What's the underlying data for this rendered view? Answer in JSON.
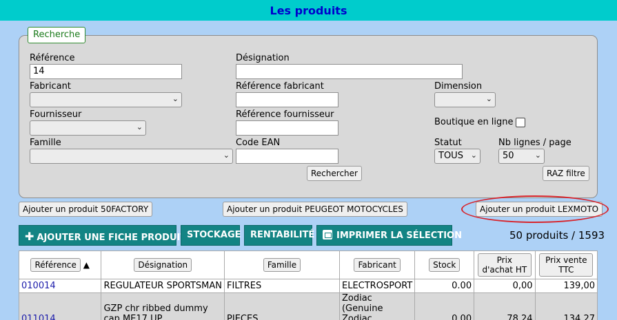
{
  "page_title": "Les produits",
  "search": {
    "legend": "Recherche",
    "reference_label": "Référence",
    "reference_value": "14",
    "designation_label": "Désignation",
    "designation_value": "",
    "fabricant_label": "Fabricant",
    "fabricant_value": "",
    "ref_fabricant_label": "Référence fabricant",
    "ref_fabricant_value": "",
    "dimension_label": "Dimension",
    "dimension_value": "",
    "fournisseur_label": "Fournisseur",
    "fournisseur_value": "",
    "ref_fournisseur_label": "Référence fournisseur",
    "ref_fournisseur_value": "",
    "boutique_label": "Boutique en ligne",
    "famille_label": "Famille",
    "famille_value": "",
    "ean_label": "Code EAN",
    "ean_value": "",
    "statut_label": "Statut",
    "statut_value": "TOUS",
    "nb_lignes_label": "Nb lignes / page",
    "nb_lignes_value": "50",
    "search_button": "Rechercher",
    "reset_button": "RAZ filtre"
  },
  "add_buttons": {
    "factory": "Ajouter un produit 50FACTORY",
    "peugeot": "Ajouter un produit PEUGEOT MOTOCYCLES",
    "lexmoto": "Ajouter un produit LEXMOTO"
  },
  "actions": {
    "add_product": "AJOUTER UNE FICHE PRODUIT",
    "stockage": "STOCKAGE",
    "rentabilite": "RENTABILITÉ",
    "print": "IMPRIMER LA SÉLECTION"
  },
  "count_text": "50 produits / 1593",
  "table": {
    "headers": {
      "reference": "Référence",
      "sort_indicator": "▲",
      "designation": "Désignation",
      "famille": "Famille",
      "fabricant": "Fabricant",
      "stock": "Stock",
      "prix_achat": "Prix d'achat HT",
      "prix_vente": "Prix vente TTC"
    },
    "rows": [
      {
        "reference": "010014",
        "designation": "REGULATEUR SPORTSMAN",
        "famille": "FILTRES",
        "fabricant": "ELECTROSPORT",
        "stock": "0.00",
        "prix_achat": "0,00",
        "prix_vente": "139,00"
      },
      {
        "reference": "011014",
        "designation": "GZP chr ribbed dummy cap ME17 UP",
        "famille": "PIECES",
        "fabricant": "Zodiac (Genuine Zodiac",
        "stock": "0.00",
        "prix_achat": "78,24",
        "prix_vente": "134,27"
      }
    ]
  }
}
